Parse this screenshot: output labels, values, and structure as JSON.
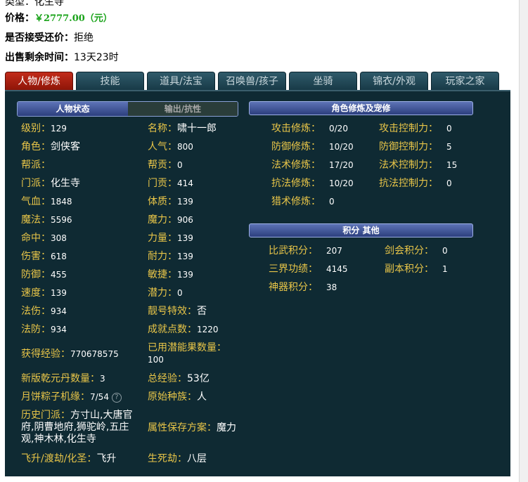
{
  "header": {
    "cut_label": "类型：化生寺",
    "price_label": "价格：",
    "price_value": "￥2777.00（元）",
    "counter_label": "是否接受还价：",
    "counter_value": "拒绝",
    "time_label": "出售剩余时间：",
    "time_value": "13天23时"
  },
  "tabs": [
    "人物/修炼",
    "技能",
    "道具/法宝",
    "召唤兽/孩子",
    "坐骑",
    "锦衣/外观",
    "玩家之家"
  ],
  "subtabs": {
    "status": "人物状态",
    "output": "输出/抗性"
  },
  "left": {
    "level": {
      "k": "级别：",
      "v": "129"
    },
    "name": {
      "k": "名称：",
      "v": "啸十一郎"
    },
    "role": {
      "k": "角色：",
      "v": "剑侠客"
    },
    "popularity": {
      "k": "人气：",
      "v": "800"
    },
    "guild": {
      "k": "帮派：",
      "v": ""
    },
    "contribution": {
      "k": "帮贡：",
      "v": "0"
    },
    "school": {
      "k": "门派：",
      "v": "化生寺"
    },
    "school_contrib": {
      "k": "门贡：",
      "v": "414"
    },
    "hp": {
      "k": "气血：",
      "v": "1848"
    },
    "constitution": {
      "k": "体质：",
      "v": "139"
    },
    "mp": {
      "k": "魔法：",
      "v": "5596"
    },
    "magic": {
      "k": "魔力：",
      "v": "906"
    },
    "hit": {
      "k": "命中：",
      "v": "308"
    },
    "strength": {
      "k": "力量：",
      "v": "139"
    },
    "damage": {
      "k": "伤害：",
      "v": "618"
    },
    "endurance": {
      "k": "耐力：",
      "v": "139"
    },
    "defense": {
      "k": "防御：",
      "v": "455"
    },
    "agility": {
      "k": "敏捷：",
      "v": "139"
    },
    "speed": {
      "k": "速度：",
      "v": "139"
    },
    "potential": {
      "k": "潜力：",
      "v": "0"
    },
    "mag_damage": {
      "k": "法伤：",
      "v": "934"
    },
    "pretty_id": {
      "k": "靓号特效：",
      "v": "否"
    },
    "mag_defense": {
      "k": "法防：",
      "v": "934"
    },
    "achievement": {
      "k": "成就点数：",
      "v": "1220"
    },
    "exp": {
      "k": "获得经验：",
      "v": "770678575"
    },
    "potential_fruit": {
      "k": "已用潜能果数量：",
      "v": "100"
    },
    "qianyuan": {
      "k": "新版乾元丹数量：",
      "v": "3"
    },
    "total_exp": {
      "k": "总经验：",
      "v": "53亿"
    },
    "mooncake": {
      "k": "月饼粽子机缘：",
      "v": "7/54"
    },
    "race": {
      "k": "原始种族：",
      "v": "人"
    },
    "history_school": {
      "k": "历史门派：",
      "v": "方寸山,大唐官府,阴曹地府,狮驼岭,五庄观,神木林,化生寺"
    },
    "attr_save": {
      "k": "属性保存方案：",
      "v": "魔力"
    },
    "ascension": {
      "k": "飞升/渡劫/化圣：",
      "v": "飞升"
    },
    "life_death": {
      "k": "生死劫：",
      "v": "八层"
    }
  },
  "cultivation": {
    "title": "角色修炼及宠修",
    "rows": [
      {
        "k1": "攻击修炼：",
        "v1": "0/20",
        "k2": "攻击控制力：",
        "v2": "0"
      },
      {
        "k1": "防御修炼：",
        "v1": "10/20",
        "k2": "防御控制力：",
        "v2": "5"
      },
      {
        "k1": "法术修炼：",
        "v1": "17/20",
        "k2": "法术控制力：",
        "v2": "15"
      },
      {
        "k1": "抗法修炼：",
        "v1": "10/20",
        "k2": "抗法控制力：",
        "v2": "0"
      },
      {
        "k1": "猎术修炼：",
        "v1": "0",
        "k2": "",
        "v2": ""
      }
    ]
  },
  "points": {
    "title": "积分 其他",
    "rows": [
      {
        "k1": "比武积分：",
        "v1": "207",
        "k2": "剑会积分：",
        "v2": "0"
      },
      {
        "k1": "三界功绩：",
        "v1": "4145",
        "k2": "副本积分：",
        "v2": "1"
      },
      {
        "k1": "神器积分：",
        "v1": "38",
        "k2": "",
        "v2": ""
      }
    ]
  },
  "icons": {
    "help": "question-circle-icon"
  },
  "colors": {
    "panel_bg": "#0f2a33",
    "label": "#e8c548",
    "active_tab": "#c22b1a",
    "price": "#1aa31a"
  }
}
